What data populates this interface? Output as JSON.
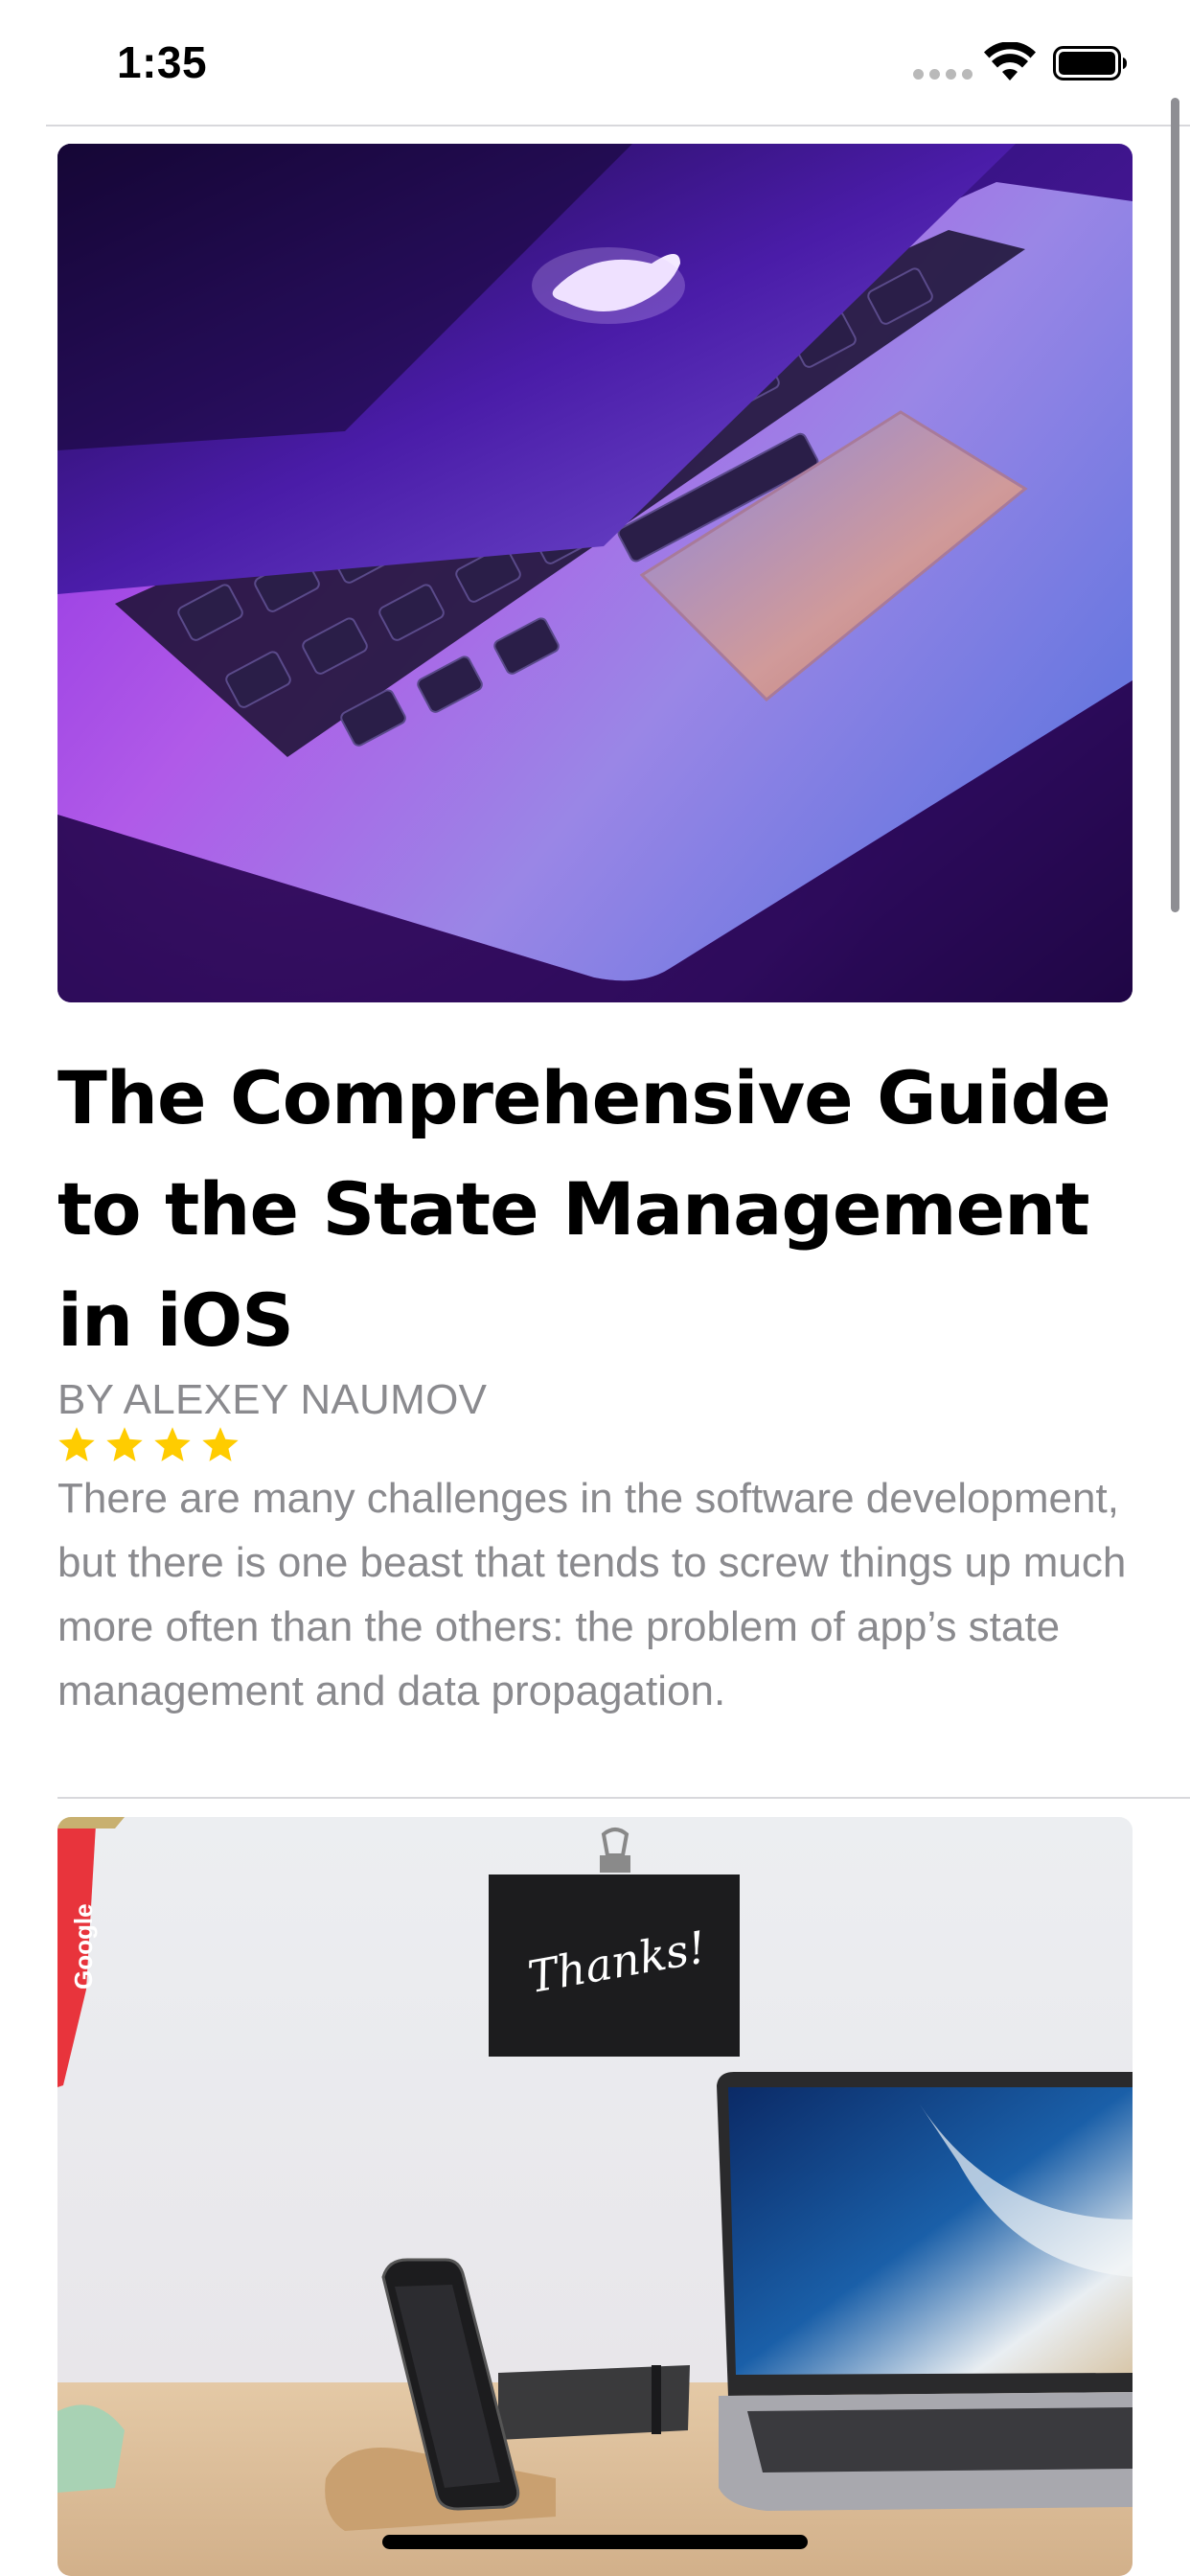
{
  "status_bar": {
    "time": "1:35",
    "icons": [
      "signal-dots-icon",
      "wifi-icon",
      "battery-icon"
    ]
  },
  "articles": [
    {
      "image": "laptop-photo",
      "title": "The Comprehensive Guide to the State Management in iOS",
      "author": "BY ALEXEY NAUMOV",
      "rating": 4,
      "summary": "There are many challenges in the software development, but there is one beast that tends to screw things up much more often than the others: the problem of app’s state management and data propagation."
    },
    {
      "image": "desk-photo",
      "image_text": "Thanks!",
      "lanyard_text": "Google"
    }
  ],
  "colors": {
    "star": "#FFCC00",
    "secondary_text": "#8A8A8E",
    "divider": "#D8D8DC"
  }
}
